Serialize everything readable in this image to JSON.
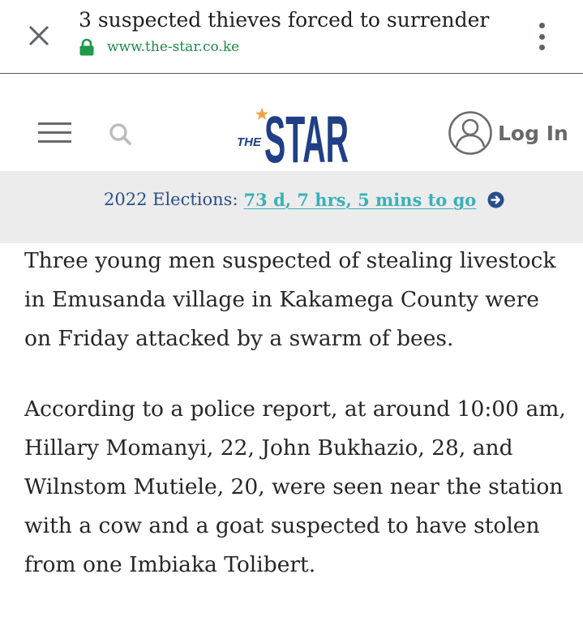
{
  "tab_bar": {
    "title": "3 suspected thieves forced to surrender",
    "url": "www.the-star.co.ke",
    "icons": {
      "close": "close-icon",
      "lock": "lock-icon",
      "menu": "more-vert-icon"
    },
    "colors": {
      "url": "#1d8a4a",
      "lock": "#1d9a4a"
    }
  },
  "header": {
    "logo": {
      "small_text": "THE",
      "main_text": "STAR",
      "color": "#1f3f86",
      "star_color": "#f2a13a"
    },
    "login_label": "Log In",
    "icons": {
      "menu": "hamburger-icon",
      "search": "search-icon",
      "user": "user-avatar-icon"
    }
  },
  "banner": {
    "label": "2022 Elections:",
    "countdown": "73 d, 7 hrs, 5 mins to go",
    "icon": "arrow-right-circle-icon",
    "colors": {
      "label": "#2a4e8b",
      "countdown": "#3ab0b8",
      "background": "#ececec"
    }
  },
  "article": {
    "paragraphs": [
      "Three young men suspected of stealing livestock in Emusanda village in Kakamega County were on Friday attacked by a swarm of bees.",
      "According to a police report, at around 10:00 am, Hillary Momanyi, 22, John Bukhazio, 28, and Wilnstom Mutiele, 20, were seen near the station with a cow and a goat suspected to have stolen from one Imbiaka Tolibert."
    ]
  }
}
